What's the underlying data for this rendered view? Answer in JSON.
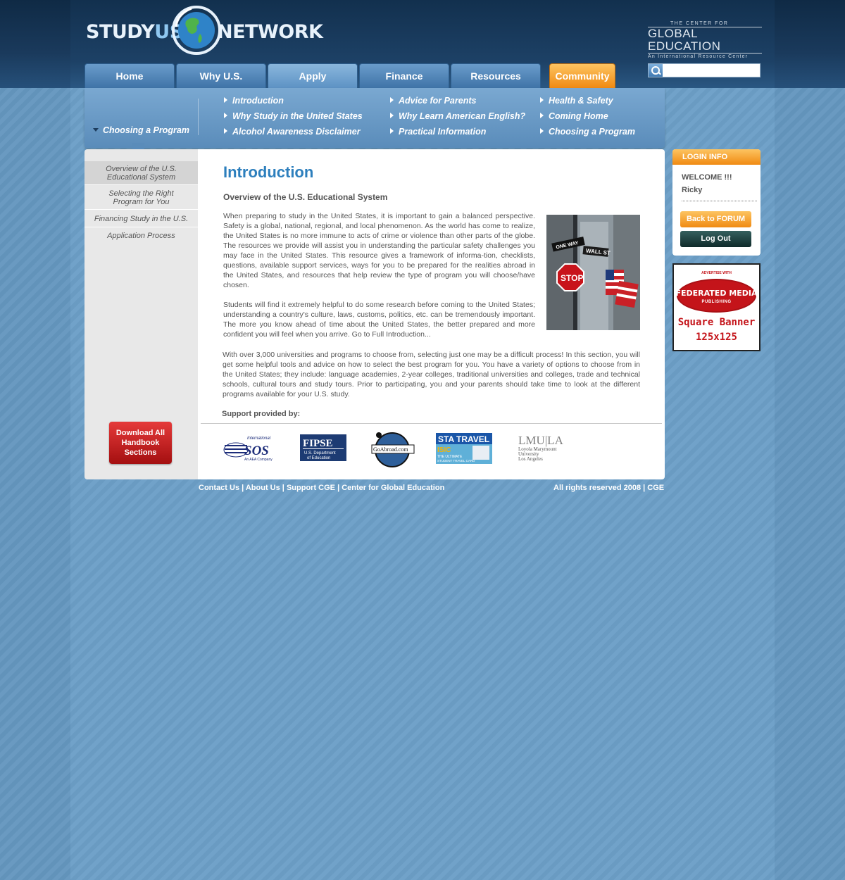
{
  "colors": {
    "background": "#6c9fc7",
    "header": "#1d4166",
    "accent_orange": "#f08a12",
    "title_blue": "#2d7fbd",
    "download_red": "#c4141a"
  },
  "header": {
    "logo_study": "STUDY",
    "logo_us": "US",
    "logo_network": "NETWORK",
    "partner_top": "THE CENTER FOR",
    "partner_main": "GLOBAL EDUCATION",
    "partner_sub": "An International Resource Center"
  },
  "nav": {
    "tabs": [
      {
        "label": "Home"
      },
      {
        "label": "Why U.S."
      },
      {
        "label": "Apply"
      },
      {
        "label": "Finance"
      },
      {
        "label": "Resources"
      },
      {
        "label": "Community"
      }
    ],
    "active_tab": "Apply"
  },
  "search": {
    "placeholder": "",
    "value": "",
    "icon": "search-icon"
  },
  "submenu": {
    "current": "Choosing a Program",
    "links": [
      [
        "Introduction",
        "Why Study in the United States",
        "Alcohol Awareness Disclaimer"
      ],
      [
        "Advice for Parents",
        "Why Learn American English?",
        "Practical Information"
      ],
      [
        "Health & Safety",
        "Coming Home",
        "Choosing a Program"
      ]
    ]
  },
  "leftnav": {
    "items": [
      {
        "label": "Overview of the U.S. Educational System",
        "active": true
      },
      {
        "label": "Selecting the Right Program for You",
        "active": false
      },
      {
        "label": "Financing Study in the U.S.",
        "active": false
      },
      {
        "label": "Application Process",
        "active": false
      }
    ],
    "download_button": "Download All Handbook Sections"
  },
  "main": {
    "title": "Introduction",
    "subtitle": "Overview of the U.S. Educational System",
    "paragraphs": [
      "When preparing to study in the United States, it is important to gain a balanced perspective. Safety is a global, national, regional, and local phenomenon. As the world has come to realize, the United States is no more immune to acts of crime or violence than other parts of the globe. The resources we provide will assist you in understanding the particular safety challenges you may face in the United States. This resource gives a framework of informa-tion, checklists, questions, available support services, ways for you to be prepared for the realities abroad in the United States, and resources that help review the type of program you will choose/have chosen.",
      "Students will find it extremely helpful to do some research before coming to the United States; understanding a country's culture, laws, customs, politics, etc. can be tremendously important. The more you know ahead of time about the United States, the better prepared and more confident you will feel when you arrive. Go to Full Introduction...",
      "With over 3,000 universities and programs to choose from, selecting just one may be a difficult process! In this section, you will get some helpful tools and advice on how to select the best program for you. You have a variety of options to choose from in the United States; they include: language academies, 2-year colleges, traditional universities and colleges, trade and technical schools, cultural tours and study tours. Prior to participating, you and your parents should take time to look at the different programs available for your U.S. study."
    ],
    "photo_signs": {
      "one_way": "ONE WAY",
      "wall_st": "WALL ST",
      "stop": "STOP"
    },
    "support_label": "Support provided by:",
    "sponsors": {
      "sos_top": "International",
      "sos_main": "SOS",
      "sos_sub": "An AEA Company",
      "fipse_main": "FIPSE",
      "fipse_sub1": "U.S. Department",
      "fipse_sub2": "of Education",
      "goabroad": "GoAbroad.com",
      "sta_main": "STA TRAVEL",
      "sta_isic": "ISIC",
      "sta_sub1": "THE ULTIMATE",
      "sta_sub2": "STUDENT TRAVEL CARD",
      "lmu_main": "LMU|LA",
      "lmu_sub1": "Loyola Marymount",
      "lmu_sub2": "University",
      "lmu_sub3": "Los Angeles"
    }
  },
  "login": {
    "heading": "LOGIN INFO",
    "welcome": "WELCOME !!!",
    "username": "Ricky",
    "forum_button": "Back to FORUM",
    "logout_button": "Log Out"
  },
  "ad": {
    "top": "ADVERTISE WITH",
    "brand": "FEDERATED MEDIA",
    "sub": "PUBLISHING",
    "line1": "Square Banner",
    "line2": "125x125"
  },
  "footer": {
    "links": [
      "Contact Us",
      "About Us",
      "Support CGE",
      "Center for Global Education"
    ],
    "separator": " | ",
    "rights": "All rights reserved 2008 | CGE"
  }
}
